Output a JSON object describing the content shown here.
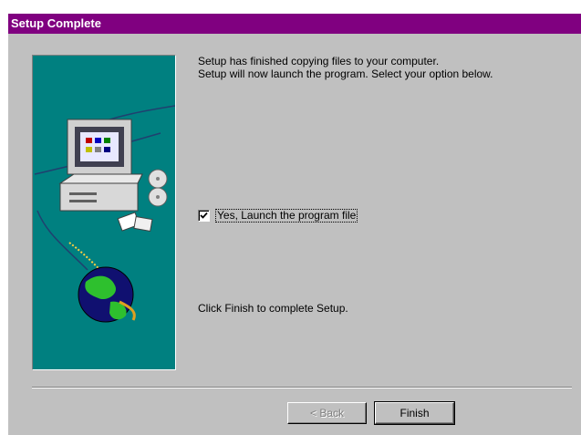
{
  "window": {
    "title": "Setup Complete",
    "titlebar_color": "#800080",
    "face_color": "#c0c0c0"
  },
  "art": {
    "background_color": "#008080",
    "icon": "computer-globe-cd-illustration"
  },
  "message": {
    "line1": "Setup has finished copying files to your computer.",
    "line2": "Setup will now launch the program. Select your option below."
  },
  "launch_option": {
    "label": "Yes, Launch the program file",
    "checked": true
  },
  "finish_hint": "Click Finish to complete Setup.",
  "buttons": {
    "back": {
      "label": "< Back",
      "enabled": false
    },
    "finish": {
      "label": "Finish",
      "enabled": true
    }
  }
}
